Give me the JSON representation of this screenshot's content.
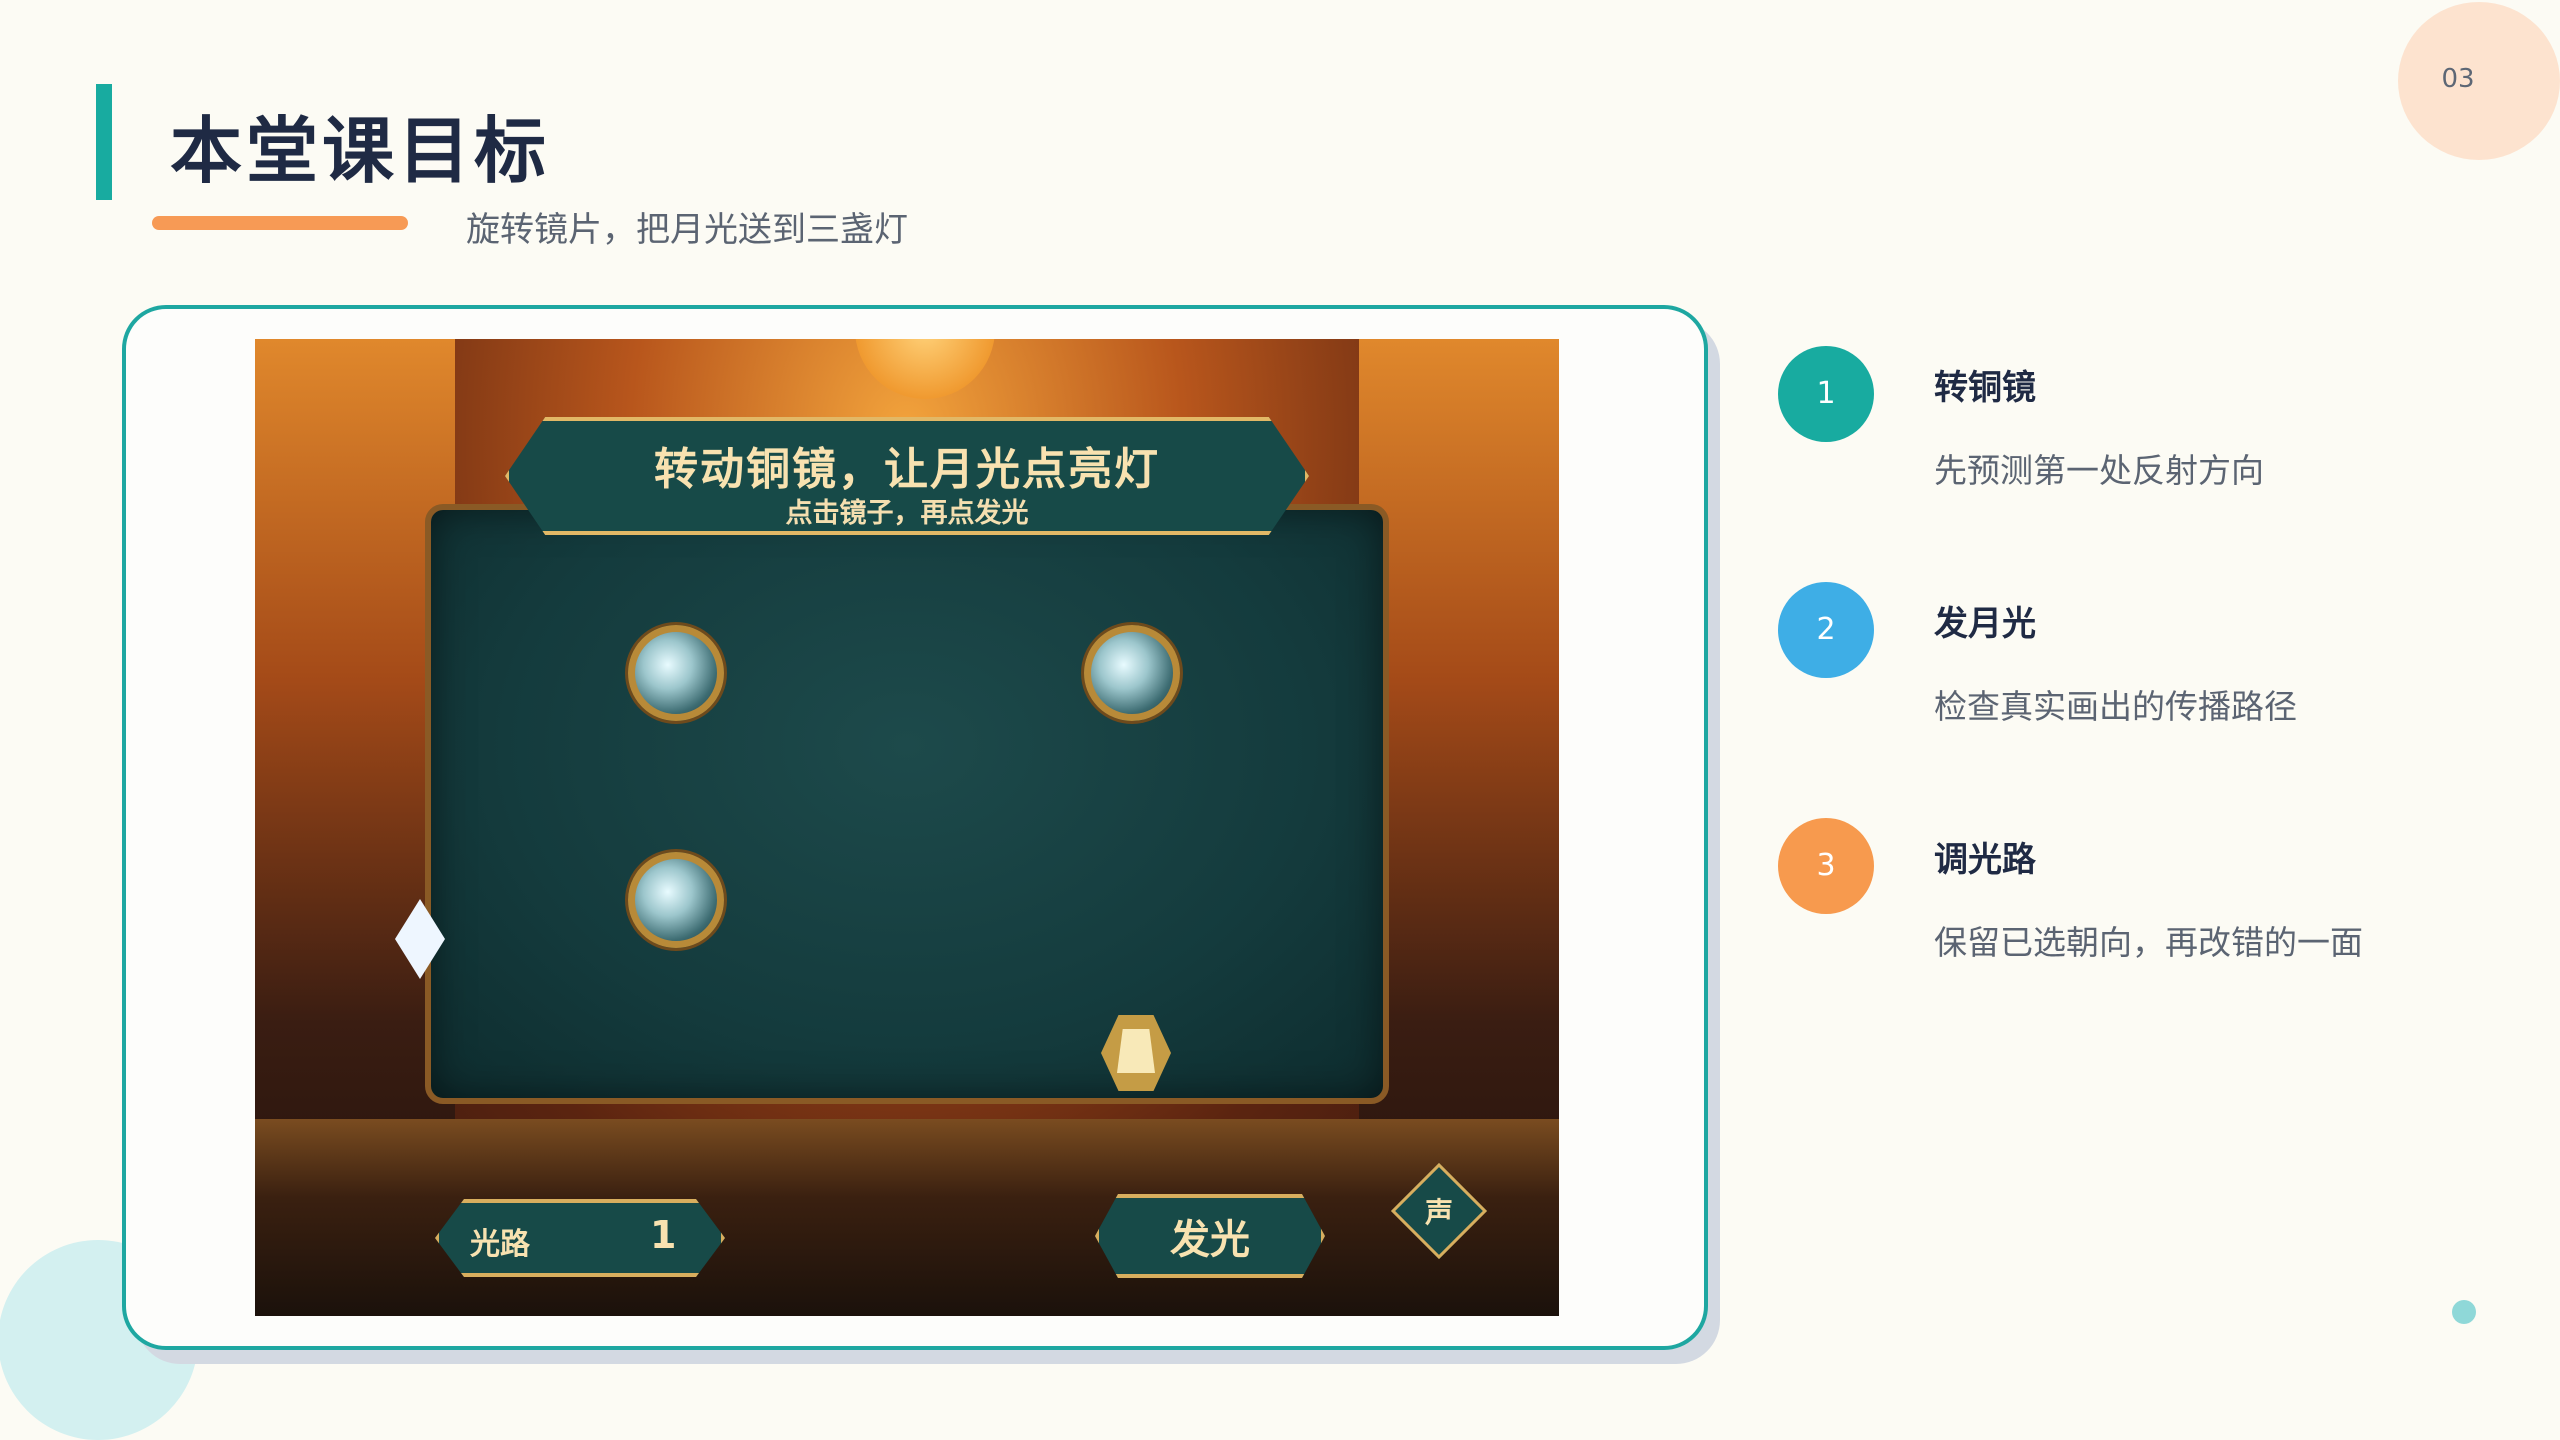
{
  "page": {
    "number": "03",
    "title": "本堂课目标",
    "subtitle": "旋转镜片，把月光送到三盏灯"
  },
  "game": {
    "banner_title": "转动铜镜，让月光点亮灯",
    "banner_subtitle": "点击镜子，再点发光",
    "path_label": "光路",
    "path_count": "1",
    "emit_button": "发光",
    "sound_button": "声"
  },
  "steps": [
    {
      "number": "1",
      "title": "转铜镜",
      "desc": "先预测第一处反射方向",
      "color": "#18aba0"
    },
    {
      "number": "2",
      "title": "发月光",
      "desc": "检查真实画出的传播路径",
      "color": "#3eaee6"
    },
    {
      "number": "3",
      "title": "调光路",
      "desc": "保留已选朝向，再改错的一面",
      "color": "#f79a4e"
    }
  ],
  "colors": {
    "accent_teal": "#18aba0",
    "accent_orange": "#f79a55",
    "background": "#fcfbf4"
  }
}
